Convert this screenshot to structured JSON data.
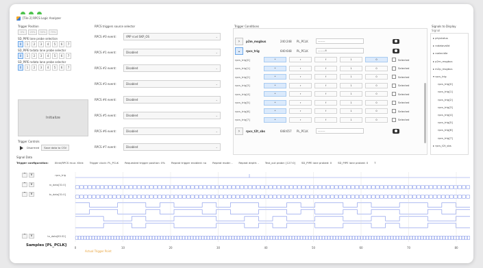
{
  "window": {
    "title": "[Tile 2] RPCS Logic Analyzer"
  },
  "trigger_position": {
    "label": "Trigger Position",
    "percent_buttons": [
      "0%",
      "25%",
      "50%",
      "75%"
    ],
    "lane_probe_label": "SD_PIPE lane probe selection",
    "lane_probe_values": [
      "0",
      "1",
      "2",
      "3",
      "4",
      "5",
      "6",
      "7"
    ],
    "txdata_label": "SD_PIPE txdata lane probe selector",
    "txdata_values": [
      "0",
      "1",
      "2",
      "3",
      "4",
      "5",
      "6",
      "7"
    ],
    "rxdata_label": "SD_PIPE rxdata lane probe selector",
    "rxdata_values": [
      "0",
      "1",
      "2",
      "3",
      "4",
      "5",
      "6",
      "7"
    ],
    "initialize_label": "Initialize"
  },
  "trigger_controls": {
    "label": "Trigger Controls",
    "state": "Disarmed",
    "save_label": "Save data to CSV"
  },
  "source_selector": {
    "label": "RPCS triggers source selector",
    "events": [
      {
        "label": "RPCS #0 event:",
        "value": "tPIP rcvd SKP_OS"
      },
      {
        "label": "RPCS #1 event:",
        "value": "Disabled"
      },
      {
        "label": "RPCS #2 event:",
        "value": "Disabled"
      },
      {
        "label": "RPCS #3 event:",
        "value": "Disabled"
      },
      {
        "label": "RPCS #4 event:",
        "value": "Disabled"
      },
      {
        "label": "RPCS #5 event:",
        "value": "Disabled"
      },
      {
        "label": "RPCS #6 event:",
        "value": "Disabled"
      },
      {
        "label": "RPCS #7 event:",
        "value": "Disabled"
      }
    ]
  },
  "trigger_conditions": {
    "label": "Trigger Conditions",
    "header_rows": [
      {
        "name": "p2m_msgbus",
        "value": "240:248",
        "clock": "PL_PCLK",
        "input": "———",
        "active": false
      },
      {
        "name": "rpcs_trig",
        "value": "640:648",
        "clock": "PL_PCLK",
        "input": "———8",
        "active": true
      }
    ],
    "bits": [
      {
        "name": "rpcs_trig[0]",
        "cells": [
          "*",
          "r",
          "f",
          "1",
          "0"
        ],
        "selected": "Selected"
      },
      {
        "name": "rpcs_trig[1]",
        "cells": [
          "*",
          "r",
          "f",
          "1",
          "0"
        ],
        "selected": "Selected"
      },
      {
        "name": "rpcs_trig[2]",
        "cells": [
          "*",
          "r",
          "f",
          "1",
          "0"
        ],
        "selected": "Selected"
      },
      {
        "name": "rpcs_trig[3]",
        "cells": [
          "*",
          "r",
          "f",
          "1",
          "0"
        ],
        "selected": "Selected"
      },
      {
        "name": "rpcs_trig[4]",
        "cells": [
          "*",
          "r",
          "f",
          "1",
          "0"
        ],
        "selected": "Selected"
      },
      {
        "name": "rpcs_trig[5]",
        "cells": [
          "*",
          "r",
          "f",
          "1",
          "0"
        ],
        "selected": "Selected"
      },
      {
        "name": "rpcs_trig[6]",
        "cells": [
          "*",
          "r",
          "f",
          "1",
          "0"
        ],
        "selected": "Selected"
      },
      {
        "name": "rpcs_trig[7]",
        "cells": [
          "*",
          "r",
          "f",
          "1",
          "0"
        ],
        "selected": "Selected"
      }
    ],
    "footer_row": {
      "name": "rpcs_t2t_sbs",
      "value": "648:657",
      "clock": "PL_PCLK",
      "input": "———"
    }
  },
  "signals": {
    "label": "Signals to Display",
    "header": "Signal",
    "items": [
      {
        "text": "▸ phystatus",
        "indent": 0
      },
      {
        "text": "▸ rxdatavalid",
        "indent": 0
      },
      {
        "text": "▸ rxelecidle",
        "indent": 0
      },
      {
        "text": "▸ p2m_msgbus",
        "indent": 0
      },
      {
        "text": "▸ m2p_msgbus",
        "indent": 0
      },
      {
        "text": "▾ rpcs_trig",
        "indent": 0
      },
      {
        "text": "rpcs_trig[0]",
        "indent": 1
      },
      {
        "text": "rpcs_trig[1]",
        "indent": 1
      },
      {
        "text": "rpcs_trig[2]",
        "indent": 1
      },
      {
        "text": "rpcs_trig[3]",
        "indent": 1
      },
      {
        "text": "rpcs_trig[4]",
        "indent": 1
      },
      {
        "text": "rpcs_trig[5]",
        "indent": 1
      },
      {
        "text": "rpcs_trig[6]",
        "indent": 1
      },
      {
        "text": "rpcs_trig[7]",
        "indent": 1
      },
      {
        "text": "▸ rpcs_t2t_sbs",
        "indent": 0
      }
    ]
  },
  "signal_data": {
    "label": "Signal Data",
    "config_title": "Trigger configuration:",
    "config_items": [
      "Xlink/RPCS mux: Xlink",
      "Trigger clock: PL_PCLK",
      "Requested trigger position: 0%",
      "Repeat trigger enabled: no",
      "Repeat mode: -",
      "Repeat depth: -",
      "Test_out probe: [127:0]",
      "SD_PIPE lane probed: 0",
      "SD_PIPE lane probed: 0",
      "T"
    ],
    "rows": [
      {
        "name": "rpcs_trig"
      },
      {
        "name": "rx_data[31:0]"
      },
      {
        "name": "tx_data[31:0]"
      },
      {
        "name": "tx_data[63:32]"
      }
    ],
    "x_ticks": [
      "0",
      "10",
      "20",
      "30",
      "40",
      "50",
      "60",
      "70",
      "80"
    ],
    "samples_label": "Samples [PL_PCLK]",
    "actual_trigger_label": "Actual Trigger Point"
  },
  "colors": {
    "accent": "#6aa6e8",
    "wave": "#7b8fe8",
    "trigger_point": "#e8a23a",
    "dot": "#4ec34e"
  }
}
